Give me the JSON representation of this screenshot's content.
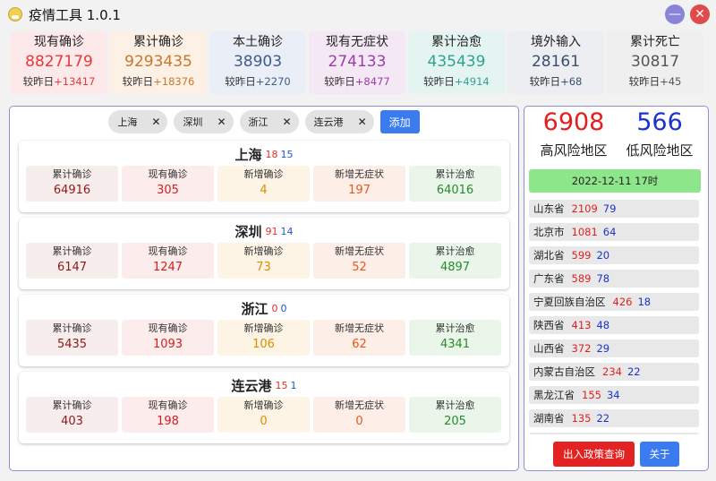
{
  "app": {
    "title": "疫情工具 1.0.1",
    "icon": "smiley-face-icon"
  },
  "window_controls": {
    "minimize_symbol": "—",
    "close_symbol": "✕"
  },
  "stats": [
    {
      "label": "现有确诊",
      "value": "8827179",
      "diff_label": "较昨日",
      "diff": "+13417",
      "value_color": "#e23b3b",
      "bg": "#fde9e9"
    },
    {
      "label": "累计确诊",
      "value": "9293435",
      "diff_label": "较昨日",
      "diff": "+18376",
      "value_color": "#c8772c",
      "bg": "#fdf0e4"
    },
    {
      "label": "本土确诊",
      "value": "38903",
      "diff_label": "较昨日",
      "diff": "+2270",
      "value_color": "#3e5c8a",
      "bg": "#eaeef6"
    },
    {
      "label": "现有无症状",
      "value": "274133",
      "diff_label": "较昨日",
      "diff": "+8477",
      "value_color": "#9b3fa6",
      "bg": "#f4e8f5"
    },
    {
      "label": "累计治愈",
      "value": "435439",
      "diff_label": "较昨日",
      "diff": "+4914",
      "value_color": "#2fa296",
      "bg": "#e3f4f1"
    },
    {
      "label": "境外输入",
      "value": "28161",
      "diff_label": "较昨日",
      "diff": "+68",
      "value_color": "#3b4f6e",
      "bg": "#eceef2"
    },
    {
      "label": "累计死亡",
      "value": "30817",
      "diff_label": "较昨日",
      "diff": "+45",
      "value_color": "#555555",
      "bg": "#efefef"
    }
  ],
  "chips": [
    {
      "label": "上海",
      "remove": "✕"
    },
    {
      "label": "深圳",
      "remove": "✕"
    },
    {
      "label": "浙江",
      "remove": "✕"
    },
    {
      "label": "连云港",
      "remove": "✕"
    }
  ],
  "add_button": "添加",
  "cell_labels": [
    "累计确诊",
    "现有确诊",
    "新增确诊",
    "新增无症状",
    "累计治愈"
  ],
  "cell_colors": [
    "#8b1a1a",
    "#d02020",
    "#d99000",
    "#e05a1a",
    "#2a8a2a"
  ],
  "cell_bgs": [
    "#f8eded",
    "#fdecec",
    "#fdf4e6",
    "#fdeee8",
    "#eaf6ea"
  ],
  "regions": [
    {
      "name": "上海",
      "high": "18",
      "low": "15",
      "values": [
        "64916",
        "305",
        "4",
        "197",
        "64016"
      ]
    },
    {
      "name": "深圳",
      "high": "91",
      "low": "14",
      "values": [
        "6147",
        "1247",
        "73",
        "52",
        "4897"
      ]
    },
    {
      "name": "浙江",
      "high": "0",
      "low": "0",
      "values": [
        "5435",
        "1093",
        "106",
        "62",
        "4341"
      ]
    },
    {
      "name": "连云港",
      "high": "15",
      "low": "1",
      "values": [
        "403",
        "198",
        "0",
        "0",
        "205"
      ]
    }
  ],
  "risk": {
    "high_count": "6908",
    "high_label": "高风险地区",
    "low_count": "566",
    "low_label": "低风险地区"
  },
  "date": "2022-12-11 17时",
  "provinces": [
    {
      "name": "山东省",
      "high": "2109",
      "low": "79"
    },
    {
      "name": "北京市",
      "high": "1081",
      "low": "64"
    },
    {
      "name": "湖北省",
      "high": "599",
      "low": "20"
    },
    {
      "name": "广东省",
      "high": "589",
      "low": "78"
    },
    {
      "name": "宁夏回族自治区",
      "high": "426",
      "low": "18"
    },
    {
      "name": "陕西省",
      "high": "413",
      "low": "48"
    },
    {
      "name": "山西省",
      "high": "372",
      "low": "29"
    },
    {
      "name": "内蒙古自治区",
      "high": "234",
      "low": "22"
    },
    {
      "name": "黑龙江省",
      "high": "155",
      "low": "34"
    },
    {
      "name": "湖南省",
      "high": "135",
      "low": "22"
    },
    {
      "name": "",
      "high": "",
      "low": ""
    }
  ],
  "policy_button": "出入政策查询",
  "about_button": "关于"
}
